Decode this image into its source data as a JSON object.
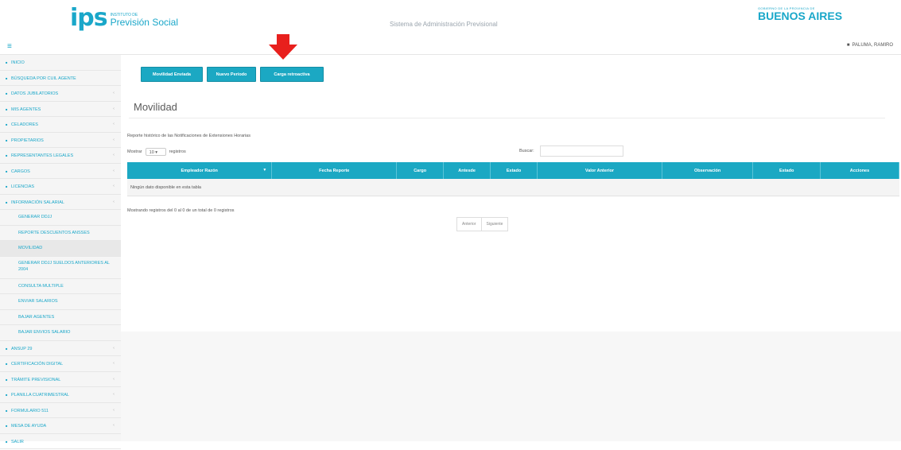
{
  "header": {
    "logo_mark": "ips",
    "logo_small": "INSTITUTO DE",
    "logo_name": "Previsión Social",
    "title": "Sistema de Administración Previsional",
    "gov_small": "GOBIERNO DE LA PROVINCIA DE",
    "gov_big": "BUENOS AIRES"
  },
  "topbar": {
    "user": "PALUMA, RAMIRO"
  },
  "sidebar": {
    "items": [
      {
        "label": "INICIO",
        "chev": ""
      },
      {
        "label": "BÚSQUEDA POR CUIL AGENTE",
        "chev": ""
      },
      {
        "label": "DATOS JUBILATORIOS",
        "chev": "‹"
      },
      {
        "label": "MIS AGENTES",
        "chev": "‹"
      },
      {
        "label": "CELADORES",
        "chev": "‹"
      },
      {
        "label": "PROPIETARIOS",
        "chev": "‹"
      },
      {
        "label": "REPRESENTANTES LEGALES",
        "chev": "‹"
      },
      {
        "label": "CARGOS",
        "chev": "‹"
      },
      {
        "label": "LICENCIAS",
        "chev": "‹"
      },
      {
        "label": "INFORMACIÓN SALARIAL",
        "chev": "‹"
      }
    ],
    "sub_items": [
      {
        "label": "GENERAR DDJJ"
      },
      {
        "label": "REPORTE DESCUENTOS ANSSES"
      },
      {
        "label": "MOVILIDAD"
      },
      {
        "label": "GENERAR DDJJ SUELDOS ANTERIORES AL 2004"
      },
      {
        "label": "CONSULTA MULTIPLE"
      },
      {
        "label": "ENVIAR SALARIOS"
      },
      {
        "label": "BAJAR AGENTES"
      },
      {
        "label": "BAJAR ENVIOS SALARIO"
      }
    ],
    "items_after": [
      {
        "label": "ANSUP 29",
        "chev": "‹"
      },
      {
        "label": "CERTIFICACIÓN DIGITAL",
        "chev": "‹"
      },
      {
        "label": "TRÁMITE PREVISIONAL",
        "chev": "‹"
      },
      {
        "label": "PLANILLA CUATRIMESTRAL",
        "chev": "‹"
      },
      {
        "label": "FORMULARIO 511",
        "chev": "‹"
      },
      {
        "label": "MESA DE AYUDA",
        "chev": "‹"
      },
      {
        "label": "SALIR",
        "chev": ""
      }
    ]
  },
  "buttons": {
    "movilidad_enviada": "Movilidad Enviada",
    "nuevo_periodo": "Nuevo Período",
    "carga_retroactiva": "Carga retroactiva"
  },
  "page": {
    "title": "Movilidad",
    "report_text": "Reporte histórico de las Notificaciones de Extensiones Horarias",
    "show_label": "Mostrar",
    "show_value": "10",
    "records_label": "registros",
    "search_label": "Buscar:",
    "info_text": "Mostrando registros del 0 al 0 de un total de 0 registros",
    "prev": "Anterior",
    "next": "Siguiente",
    "empty_text": "Ningún dato disponible en esta tabla"
  },
  "table": {
    "headers": [
      "Empleador Razón",
      "Fecha Reporte",
      "Cargo",
      "Antesde",
      "Estado",
      "Valor Anterior",
      "Observación",
      "Estado",
      "Acciones"
    ]
  },
  "colors": {
    "accent": "#1ba8c3",
    "arrow": "#e8201d"
  }
}
